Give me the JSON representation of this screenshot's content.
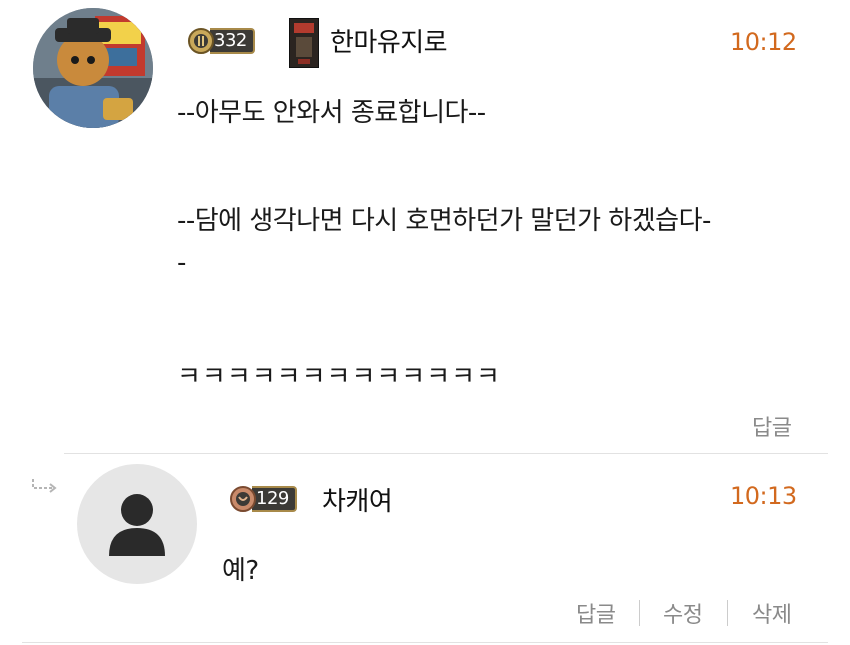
{
  "comments": [
    {
      "level": "332",
      "nickname": "한마유지로",
      "time": "10:12",
      "lines": [
        "--아무도 안와서 종료합니다--",
        "--담에 생각나면 다시 호면하던가 말던가 하겠습다-",
        "-",
        "ㅋㅋㅋㅋㅋㅋㅋㅋㅋㅋㅋㅋㅋ"
      ],
      "actions": {
        "reply": "답글"
      }
    },
    {
      "level": "129",
      "nickname": "차캐여",
      "time": "10:13",
      "lines": [
        "예?"
      ],
      "actions": {
        "reply": "답글",
        "edit": "수정",
        "delete": "삭제"
      }
    }
  ],
  "colors": {
    "time": "#d2691e",
    "action": "#8a8a8a",
    "badge_bg": "#3c3a36",
    "badge_border": "#a88a4a"
  },
  "icons": [
    "profile-avatar",
    "level-badge-icon",
    "title-icon",
    "reply-arrow-icon",
    "default-user-icon"
  ]
}
